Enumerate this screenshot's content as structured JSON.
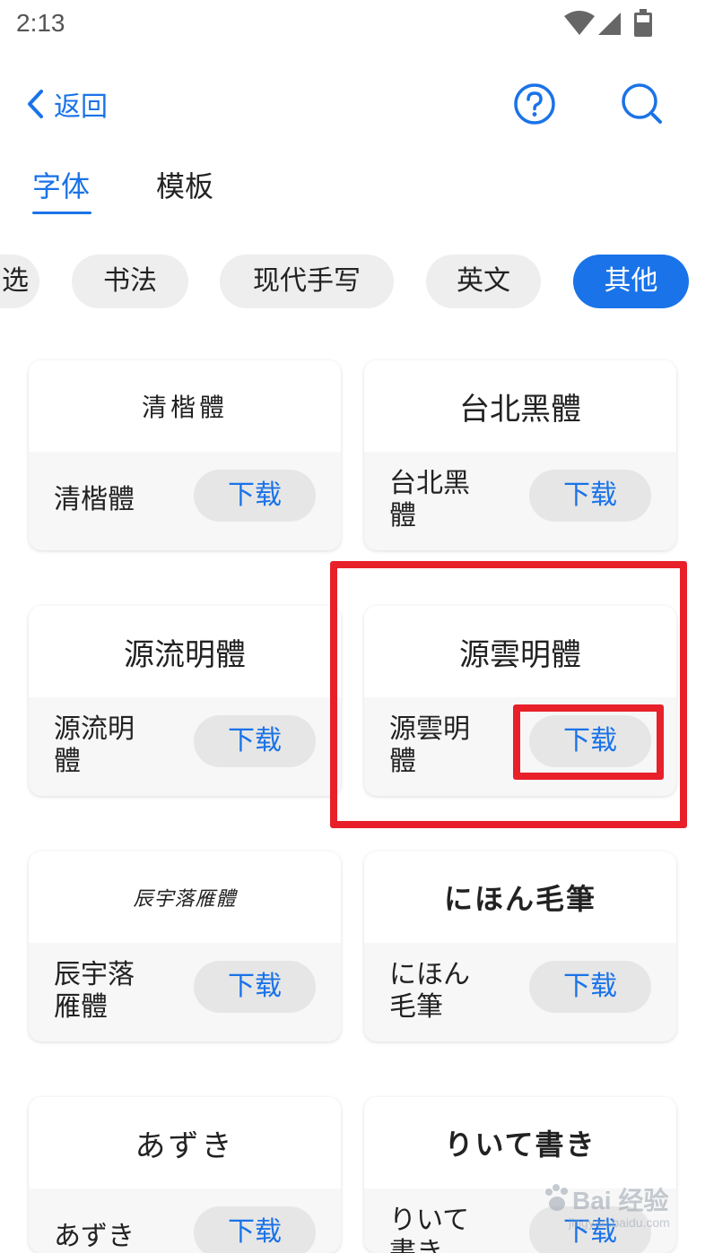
{
  "status_bar": {
    "time": "2:13",
    "icons": [
      "wifi-icon",
      "signal-icon",
      "battery-icon"
    ]
  },
  "header": {
    "back_label": "返回",
    "back_icon": "chevron-left-icon",
    "help_icon": "question-circle-icon",
    "search_icon": "search-icon",
    "accent_color": "#1a73e8"
  },
  "tabs": [
    {
      "label": "字体",
      "active": true
    },
    {
      "label": "模板",
      "active": false
    }
  ],
  "chips": [
    {
      "label": "选",
      "active": false
    },
    {
      "label": "书法",
      "active": false
    },
    {
      "label": "现代手写",
      "active": false
    },
    {
      "label": "英文",
      "active": false
    },
    {
      "label": "其他",
      "active": true
    }
  ],
  "fonts": [
    {
      "preview": "清楷體",
      "name": "清楷體",
      "button": "下载"
    },
    {
      "preview": "台北黑體",
      "name": "台北黑體",
      "button": "下载"
    },
    {
      "preview": "源流明體",
      "name": "源流明體",
      "button": "下载"
    },
    {
      "preview": "源雲明體",
      "name": "源雲明體",
      "button": "下载",
      "highlighted": true
    },
    {
      "preview": "辰宇落雁體",
      "name": "辰宇落雁體",
      "button": "下载"
    },
    {
      "preview": "にほん毛筆",
      "name": "にほん毛筆",
      "button": "下载"
    },
    {
      "preview": "あずき",
      "name": "あずき",
      "button": "下载"
    },
    {
      "preview": "りいて書き",
      "name": "りいて書き",
      "button": "下载"
    }
  ],
  "highlight_color": "#e8202a",
  "watermark": {
    "text": "Bai 经验",
    "sub": "jingyan.baidu.com"
  }
}
